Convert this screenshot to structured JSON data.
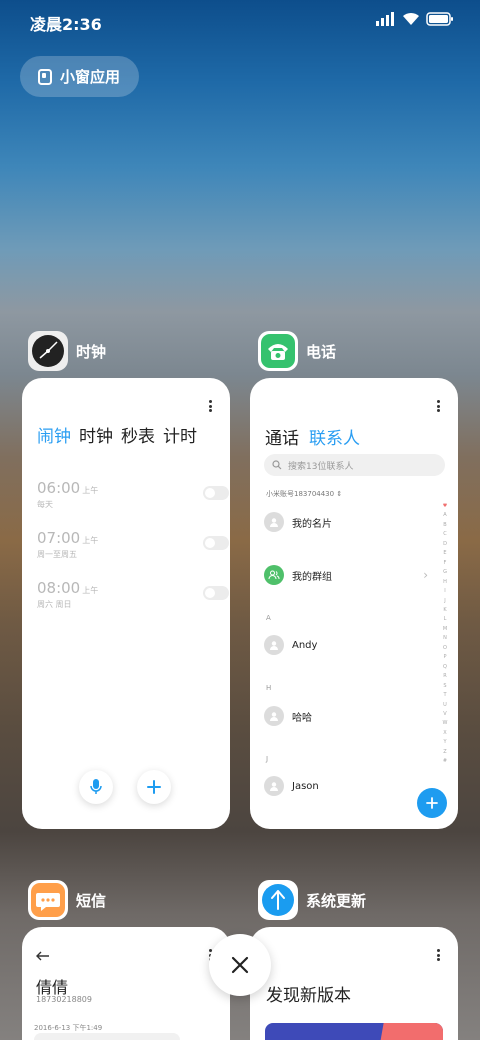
{
  "status_bar": {
    "time": "凌晨2:36",
    "icons": [
      "signal-icon",
      "wifi-icon",
      "battery-icon"
    ]
  },
  "floating_window_button": {
    "label": "小窗应用",
    "icon": "floating-window-icon"
  },
  "cards": {
    "clock": {
      "app_name": "时钟",
      "tabs": [
        "闹钟",
        "时钟",
        "秒表",
        "计时"
      ],
      "active_tab": "闹钟",
      "alarms": [
        {
          "time": "06:00",
          "ampm": "上午",
          "repeat": "每天"
        },
        {
          "time": "07:00",
          "ampm": "上午",
          "repeat": "周一至周五"
        },
        {
          "time": "08:00",
          "ampm": "上午",
          "repeat": "周六 周日"
        }
      ]
    },
    "phone": {
      "app_name": "电话",
      "tabs": [
        "通话",
        "联系人"
      ],
      "active_tab": "联系人",
      "search_placeholder": "搜索13位联系人",
      "account": "小米账号183704430",
      "contacts": [
        {
          "name": "我的名片",
          "section": ""
        },
        {
          "name": "我的群组",
          "section": ""
        },
        {
          "name": "Andy",
          "section": "A"
        },
        {
          "name": "哈哈",
          "section": "H"
        },
        {
          "name": "Jason",
          "section": "J"
        }
      ],
      "index_letters": [
        "♥",
        "A",
        "B",
        "C",
        "D",
        "E",
        "F",
        "G",
        "H",
        "I",
        "J",
        "K",
        "L",
        "M",
        "N",
        "O",
        "P",
        "Q",
        "R",
        "S",
        "T",
        "U",
        "V",
        "W",
        "X",
        "Y",
        "Z",
        "#"
      ]
    },
    "sms": {
      "app_name": "短信",
      "contact_name": "倩倩",
      "phone_number": "18730218809",
      "date": "2016-6-13 下午1:49"
    },
    "update": {
      "app_name": "系统更新",
      "title": "发现新版本"
    }
  },
  "colors": {
    "accent": "#2b9ef2",
    "fab": "#1e9cf0",
    "phone_icon": "#35c26e",
    "sms_icon": "#ff9f4a",
    "update_icon": "#1a9cf0"
  }
}
